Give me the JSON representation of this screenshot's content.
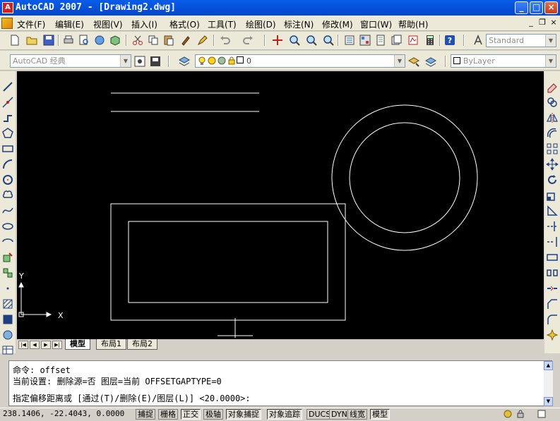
{
  "window": {
    "title": "AutoCAD 2007 - [Drawing2.dwg]",
    "app_icon_glyph": "A",
    "minimize": "_",
    "maximize": "□",
    "close": "×"
  },
  "menu": {
    "items": [
      "文件(F)",
      "编辑(E)",
      "视图(V)",
      "插入(I)",
      "格式(O)",
      "工具(T)",
      "绘图(D)",
      "标注(N)",
      "修改(M)",
      "窗口(W)",
      "帮助(H)"
    ],
    "mdi_min": "_",
    "mdi_restore": "❐",
    "mdi_close": "×"
  },
  "toolbar": {
    "text_style": "Standard"
  },
  "toolbar2": {
    "workspace": "AutoCAD 经典",
    "layer": "0",
    "color": "ByLayer"
  },
  "ucs": {
    "x_label": "X",
    "y_label": "Y"
  },
  "tabs": {
    "nav_first": "|◀",
    "nav_prev": "◀",
    "nav_next": "▶",
    "nav_last": "▶|",
    "items": [
      "模型",
      "布局1",
      "布局2"
    ]
  },
  "command": {
    "line1": "命令:  offset",
    "line2": "当前设置: 删除源=否  图层=当前  OFFSETGAPTYPE=0",
    "line3": "指定偏移距离或 [通过(T)/删除(E)/图层(L)] <20.0000>:"
  },
  "status": {
    "coords": "238.1406, -22.4043, 0.0000",
    "buttons": [
      "捕捉",
      "栅格",
      "正交",
      "极轴",
      "对象捕捉",
      "对象追踪",
      "DUCS",
      "DYN",
      "线宽",
      "模型"
    ],
    "on_states": [
      false,
      false,
      true,
      false,
      true,
      true,
      false,
      false,
      false,
      true
    ]
  },
  "colors": {
    "title_bar": "#0654de",
    "canvas_bg": "#000000",
    "entity_stroke": "#ffffff"
  }
}
